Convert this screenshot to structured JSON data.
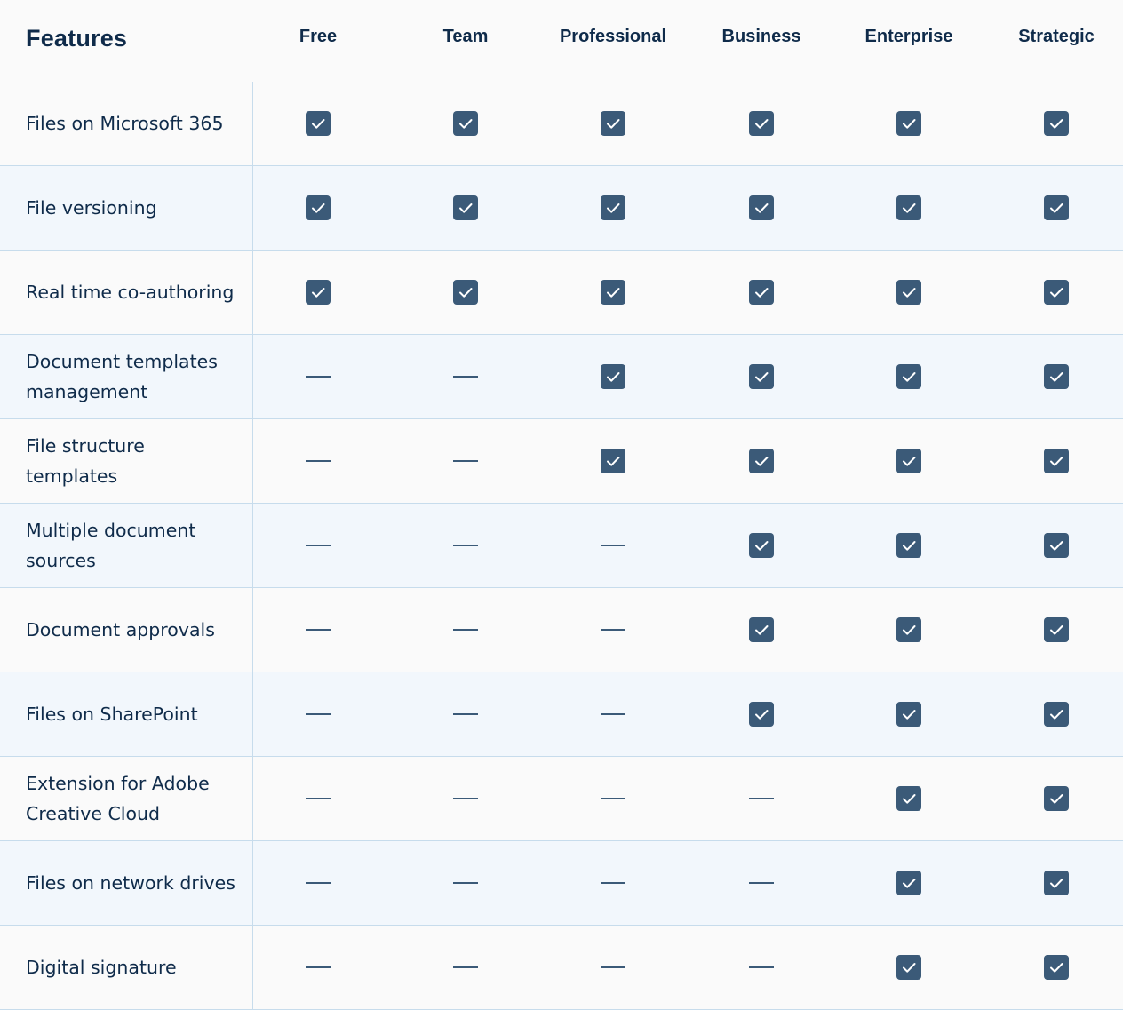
{
  "header": {
    "features_title": "Features",
    "plans": [
      "Free",
      "Team",
      "Professional",
      "Business",
      "Enterprise",
      "Strategic"
    ]
  },
  "colors": {
    "accent": "#3b5a78",
    "text": "#0f2b4a",
    "row_alt": "#f2f7fc",
    "border": "#c7dcec"
  },
  "icons": {
    "included": "check-icon",
    "not_included": "dash-icon"
  },
  "rows": [
    {
      "feature": "Files on Microsoft 365",
      "included": [
        true,
        true,
        true,
        true,
        true,
        true
      ]
    },
    {
      "feature": "File versioning",
      "included": [
        true,
        true,
        true,
        true,
        true,
        true
      ]
    },
    {
      "feature": "Real time co-authoring",
      "included": [
        true,
        true,
        true,
        true,
        true,
        true
      ]
    },
    {
      "feature": "Document templates management",
      "included": [
        false,
        false,
        true,
        true,
        true,
        true
      ]
    },
    {
      "feature": "File structure templates",
      "included": [
        false,
        false,
        true,
        true,
        true,
        true
      ]
    },
    {
      "feature": "Multiple document sources",
      "included": [
        false,
        false,
        false,
        true,
        true,
        true
      ]
    },
    {
      "feature": "Document approvals",
      "included": [
        false,
        false,
        false,
        true,
        true,
        true
      ]
    },
    {
      "feature": "Files on SharePoint",
      "included": [
        false,
        false,
        false,
        true,
        true,
        true
      ]
    },
    {
      "feature": "Extension for Adobe Creative Cloud",
      "included": [
        false,
        false,
        false,
        false,
        true,
        true
      ]
    },
    {
      "feature": "Files on network drives",
      "included": [
        false,
        false,
        false,
        false,
        true,
        true
      ]
    },
    {
      "feature": "Digital signature",
      "included": [
        false,
        false,
        false,
        false,
        true,
        true
      ]
    }
  ]
}
